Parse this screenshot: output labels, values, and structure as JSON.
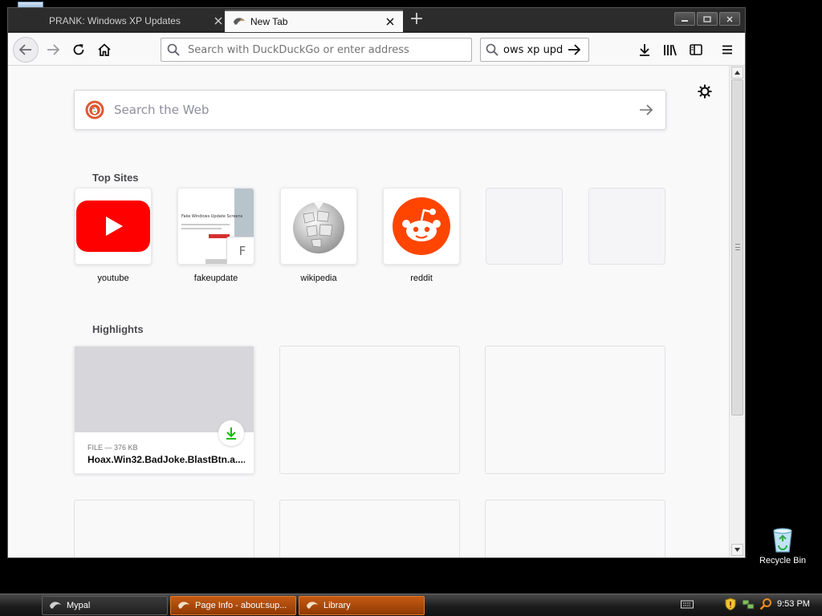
{
  "window": {
    "tabs": [
      {
        "label": "PRANK: Windows XP Updates",
        "active": false
      },
      {
        "label": "New Tab",
        "active": true
      }
    ]
  },
  "toolbar": {
    "url_placeholder": "Search with DuckDuckGo or enter address",
    "search_value": "ows xp upda"
  },
  "newtab": {
    "search_placeholder": "Search the Web",
    "top_sites_title": "Top Sites",
    "top_sites": [
      {
        "label": "youtube",
        "icon": "youtube-icon"
      },
      {
        "label": "fakeupdate",
        "icon": "fakeupdate-thumbnail",
        "badge": "F",
        "preview_heading": "Fake Windows Update Screens"
      },
      {
        "label": "wikipedia",
        "icon": "wikipedia-globe-icon"
      },
      {
        "label": "reddit",
        "icon": "reddit-icon"
      },
      {
        "label": "",
        "icon": ""
      },
      {
        "label": "",
        "icon": ""
      }
    ],
    "highlights_title": "Highlights",
    "highlights": [
      {
        "meta": "FILE — 376 KB",
        "title": "Hoax.Win32.BadJoke.BlastBtn.a....",
        "icon": "download-icon"
      }
    ]
  },
  "desktop": {
    "recycle_bin_label": "Recycle Bin"
  },
  "taskbar": {
    "items": [
      {
        "label": "Mypal",
        "style": "dark"
      },
      {
        "label": "Page Info - about:sup...",
        "style": "orange"
      },
      {
        "label": "Library",
        "style": "orange"
      }
    ],
    "clock": "9:53 PM"
  },
  "colors": {
    "youtube_red": "#ff0000",
    "reddit_orange": "#ff4500",
    "download_green": "#12bc00",
    "taskbar_orange": "#c55a12"
  }
}
